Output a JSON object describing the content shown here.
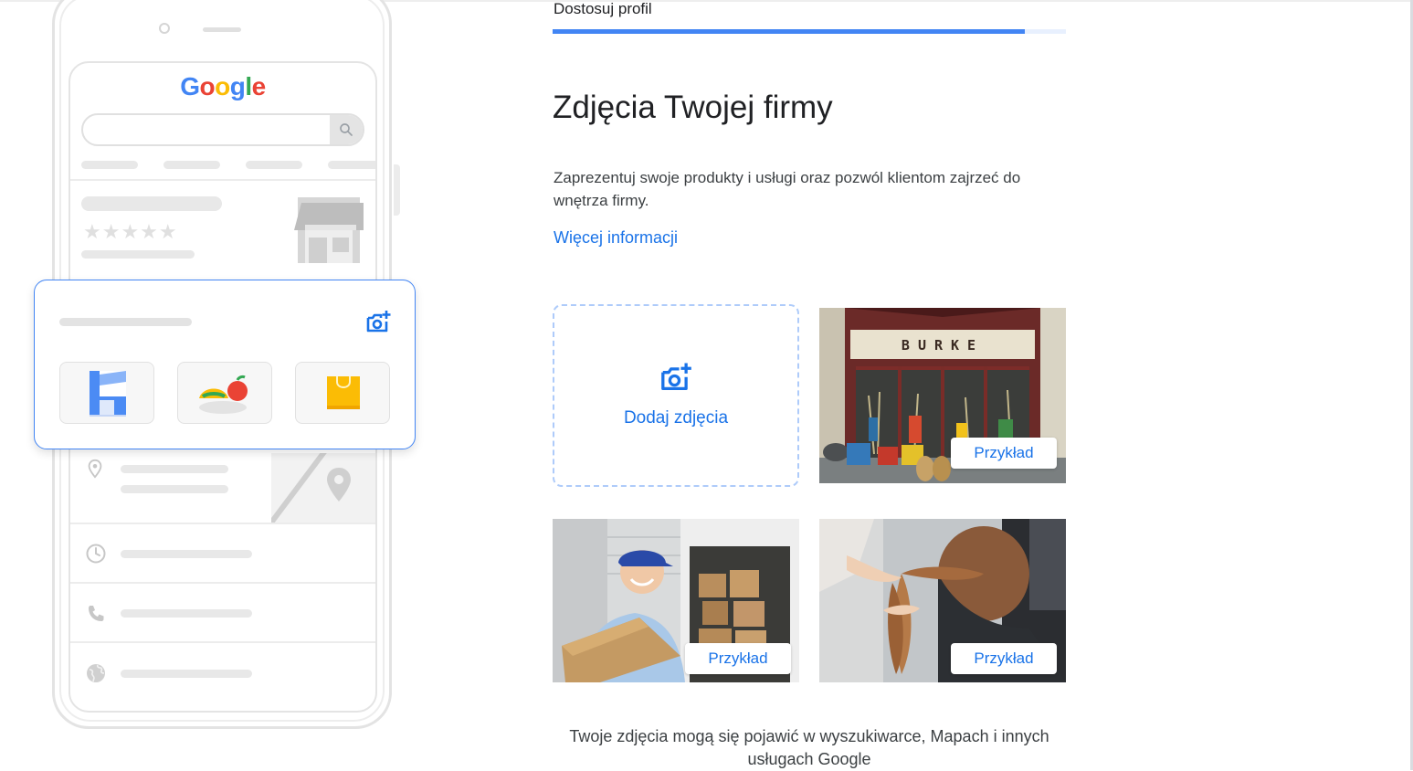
{
  "header": {
    "breadcrumb": "Dostosuj profil",
    "progress_percent": 92
  },
  "main": {
    "title": "Zdjęcia Twojej firmy",
    "description": "Zaprezentuj swoje produkty i usługi oraz pozwól klientom zajrzeć do wnętrza firmy.",
    "more_link": "Więcej informacji",
    "add_photos_label": "Dodaj zdjęcia",
    "example_badge_1": "Przykład",
    "example_badge_2": "Przykład",
    "example_badge_3": "Przykład",
    "shop_sign": "BURKE",
    "footer_note": "Twoje zdjęcia mogą się pojawić w wyszukiwarce, Mapach i innych usługach Google"
  },
  "illustration": {
    "logo_letters": [
      "G",
      "o",
      "o",
      "g",
      "l",
      "e"
    ],
    "logo_colors": [
      "#4285f4",
      "#ea4335",
      "#fbbc05",
      "#4285f4",
      "#34a853",
      "#ea4335"
    ],
    "stars": "★★★★★"
  },
  "colors": {
    "accent": "#1a73e8",
    "progress_track": "#e8f0fe",
    "progress_fill": "#4285f4",
    "card_border": "#4285f4",
    "dashed_border": "#aecbfa"
  },
  "icons": {
    "add_photo": "add-photo-camera-icon",
    "search": "search-icon",
    "pin": "location-pin-icon",
    "clock": "clock-icon",
    "phone": "phone-icon",
    "globe": "globe-icon"
  }
}
